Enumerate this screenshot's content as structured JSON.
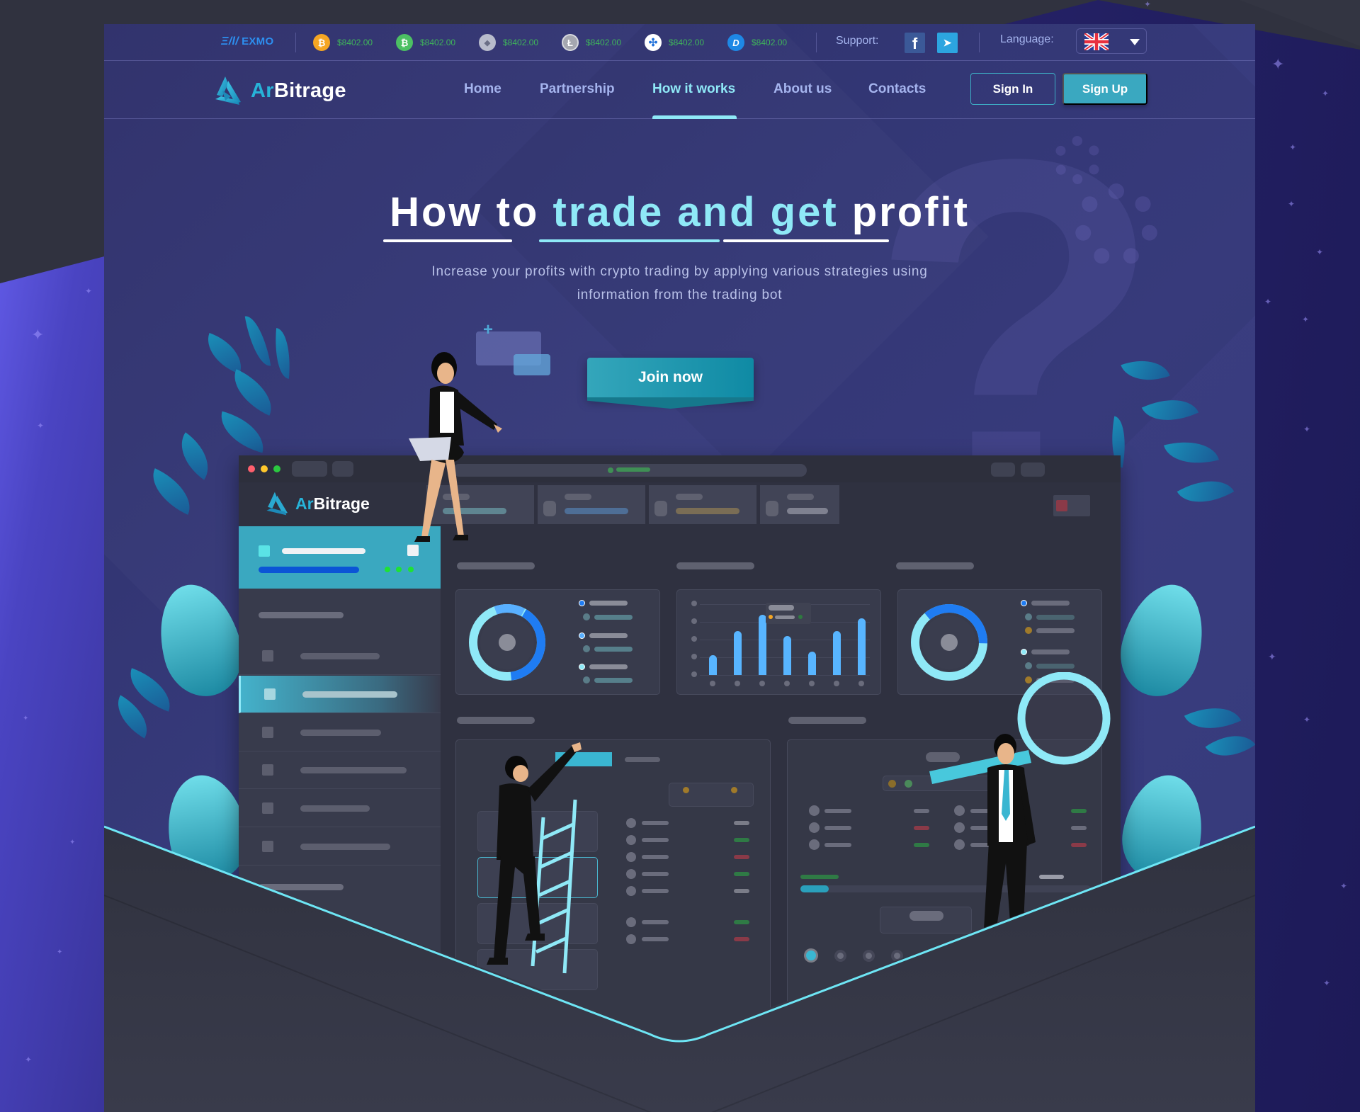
{
  "ticker": {
    "exchange": "EXMO",
    "exchange_mark": "Ξ/l/",
    "coins": [
      {
        "name": "Bitcoin",
        "icon": "bitcoin-icon",
        "glyph": "₿",
        "color": "#f5a623",
        "price": "$8402.00"
      },
      {
        "name": "Bitcoin Cash",
        "icon": "bitcoin-cash-icon",
        "glyph": "₿",
        "color": "#4cc063",
        "price": "$8402.00"
      },
      {
        "name": "Ethereum",
        "icon": "ethereum-icon",
        "glyph": "◆",
        "color": "#b8bccc",
        "price": "$8402.00"
      },
      {
        "name": "Litecoin",
        "icon": "litecoin-icon",
        "glyph": "Ł",
        "color": "#a5a7b0",
        "price": "$8402.00"
      },
      {
        "name": "Ripple",
        "icon": "ripple-icon",
        "glyph": "✣",
        "color": "#ffffff",
        "price": "$8402.00"
      },
      {
        "name": "Dash",
        "icon": "dash-icon",
        "glyph": "D",
        "color": "#1e88e5",
        "price": "$8402.00"
      }
    ],
    "support_label": "Support:",
    "facebook_glyph": "f",
    "telegram_glyph": "➤",
    "language_label": "Language:",
    "language_selected": "English (UK)"
  },
  "nav": {
    "brand_prefix": "Ar",
    "brand_suffix": "Bitrage",
    "items": [
      {
        "label": "Home",
        "active": false
      },
      {
        "label": "Partnership",
        "active": false
      },
      {
        "label": "How it works",
        "active": true
      },
      {
        "label": "About us",
        "active": false
      },
      {
        "label": "Contacts",
        "active": false
      }
    ],
    "sign_in": "Sign In",
    "sign_up": "Sign Up"
  },
  "hero": {
    "title_part1": "How to ",
    "title_highlight": "trade and get",
    "title_part2": " profit",
    "subtitle_line1": "Increase your profits with crypto trading by applying various strategies using",
    "subtitle_line2": "information from the trading bot",
    "cta": "Join now",
    "decor_question": "?",
    "chat_plus": "+"
  },
  "colors": {
    "accent": "#8fe9f7",
    "primary_button": "#3aa8c0",
    "nav_text": "#a5b4ee",
    "price_green": "#3fb55a",
    "frame_bg": "#353879",
    "dashboard_bg": "#2f3140"
  },
  "illustration": {
    "dashboard_brand_prefix": "Ar",
    "dashboard_brand_suffix": "Bitrage",
    "bar_chart_values": [
      0.28,
      0.62,
      0.85,
      0.55,
      0.33,
      0.62,
      0.8
    ],
    "donut_left": {
      "segments": [
        0.4,
        0.15,
        0.45
      ]
    },
    "donut_right": {
      "segments": [
        0.35,
        0.65
      ]
    }
  }
}
